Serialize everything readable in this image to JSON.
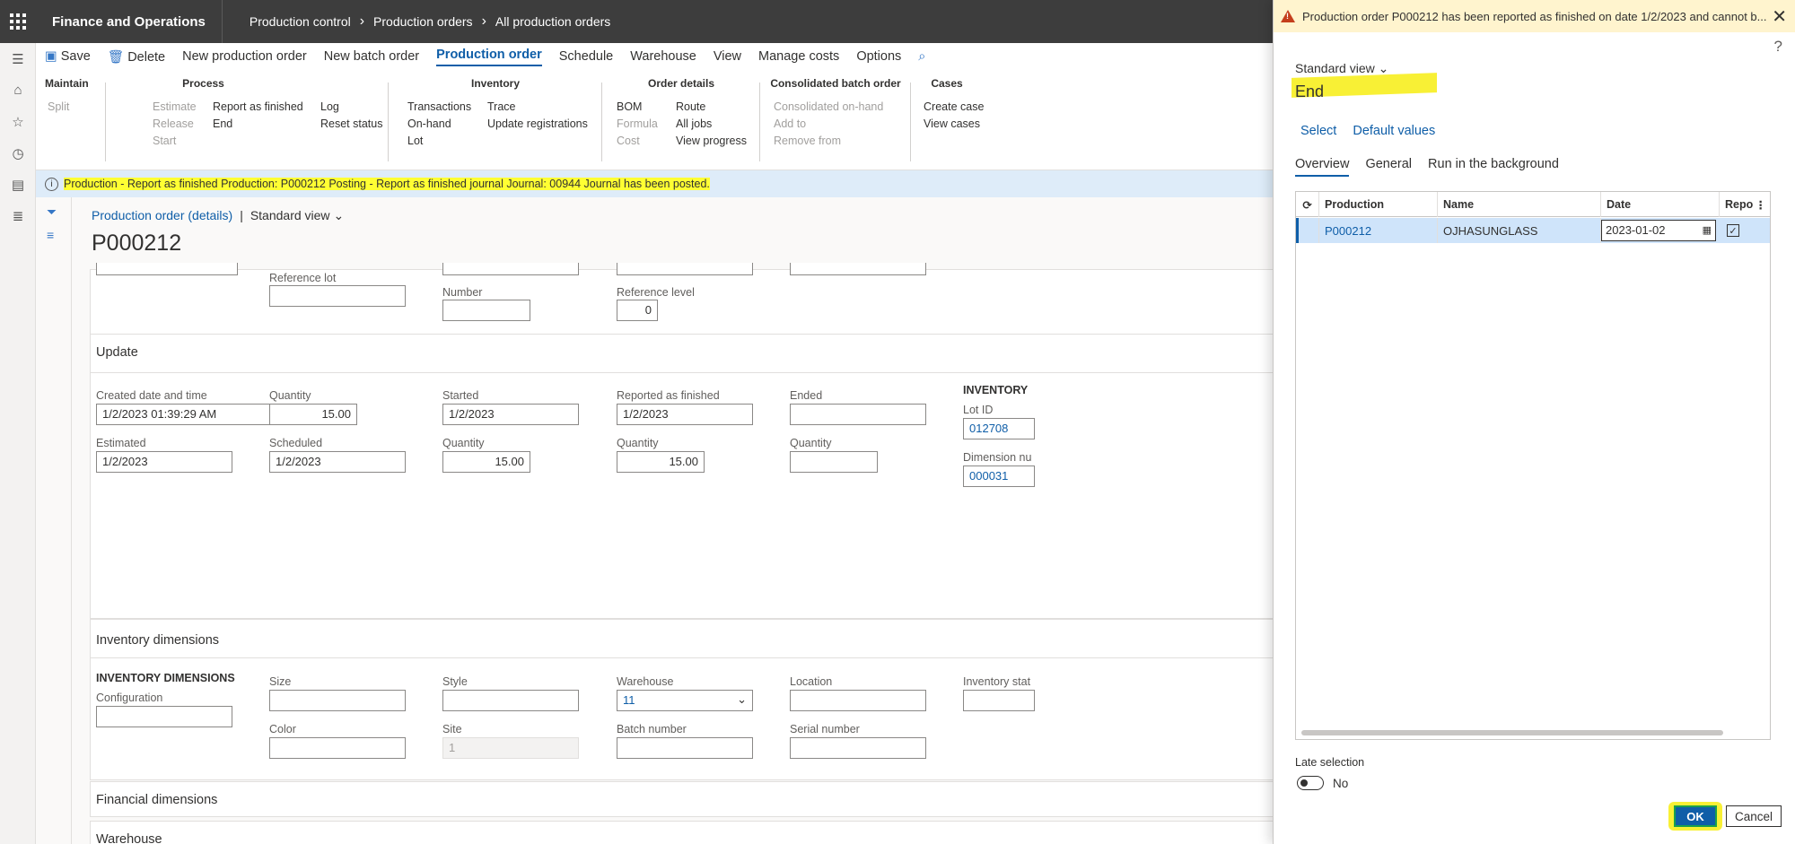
{
  "topbar": {
    "app_title": "Finance and Operations",
    "breadcrumb": [
      "Production control",
      "Production orders",
      "All production orders"
    ]
  },
  "actions": {
    "save": "Save",
    "delete": "Delete",
    "new_production_order": "New production order",
    "new_batch_order": "New batch order",
    "tabs": [
      "Production order",
      "Schedule",
      "Warehouse",
      "View",
      "Manage costs",
      "Options"
    ]
  },
  "ribbon": {
    "maintain": {
      "title": "Maintain",
      "split": "Split"
    },
    "process": {
      "title": "Process",
      "estimate": "Estimate",
      "release": "Release",
      "start": "Start",
      "report_as_finished": "Report as finished",
      "end": "End",
      "log": "Log",
      "reset_status": "Reset status"
    },
    "inventory": {
      "title": "Inventory",
      "transactions": "Transactions",
      "on_hand": "On-hand",
      "lot": "Lot",
      "trace": "Trace",
      "update_registrations": "Update registrations"
    },
    "order_details": {
      "title": "Order details",
      "bom": "BOM",
      "formula": "Formula",
      "cost": "Cost",
      "route": "Route",
      "all_jobs": "All jobs",
      "view_progress": "View progress"
    },
    "consolidated": {
      "title": "Consolidated batch order",
      "consolidated_on_hand": "Consolidated on-hand",
      "add_to": "Add to",
      "remove_from": "Remove from"
    },
    "cases": {
      "title": "Cases",
      "create_case": "Create case",
      "view_cases": "View cases"
    }
  },
  "infobar": {
    "message_highlighted": "Production - Report as finished  Production: P000212 Posting - Report as finished journal Journal: 00944 Journal has been posted.",
    "message_rest": ""
  },
  "page": {
    "crumb": "Production order (details)",
    "view": "Standard view",
    "title": "P000212"
  },
  "references": {
    "reference_lot_label": "Reference lot",
    "number_label": "Number",
    "reference_level_label": "Reference level",
    "reference_level_value": "0"
  },
  "update": {
    "title": "Update",
    "created_label": "Created date and time",
    "created_value": "1/2/2023 01:39:29 AM",
    "quantity_label": "Quantity",
    "quantity_value": "15.00",
    "started_label": "Started",
    "started_value": "1/2/2023",
    "reported_label": "Reported as finished",
    "reported_value": "1/2/2023",
    "ended_label": "Ended",
    "estimated_label": "Estimated",
    "estimated_value": "1/2/2023",
    "scheduled_label": "Scheduled",
    "scheduled_value": "1/2/2023",
    "quantity2_label": "Quantity",
    "quantity2_value": "15.00",
    "quantity3_label": "Quantity",
    "quantity3_value": "15.00",
    "quantity4_label": "Quantity",
    "inventory_heading": "INVENTORY",
    "lot_id_label": "Lot ID",
    "lot_id_value": "012708",
    "dimension_label": "Dimension nu",
    "dimension_value": "000031"
  },
  "inventory_dimensions": {
    "title": "Inventory dimensions",
    "heading": "INVENTORY DIMENSIONS",
    "configuration": "Configuration",
    "size": "Size",
    "color": "Color",
    "style": "Style",
    "site": "Site",
    "site_value": "1",
    "warehouse": "Warehouse",
    "warehouse_value": "11",
    "batch_number": "Batch number",
    "location": "Location",
    "serial_number": "Serial number",
    "inventory_status": "Inventory stat"
  },
  "sections": {
    "financial_dimensions": "Financial dimensions",
    "warehouse": "Warehouse"
  },
  "dialog": {
    "warning": "Production order P000212 has been reported as finished on date 1/2/2023 and cannot b...",
    "help": "?",
    "view": "Standard view",
    "title": "End",
    "select": "Select",
    "default_values": "Default values",
    "tabs": [
      "Overview",
      "General",
      "Run in the background"
    ],
    "grid": {
      "headers": [
        "Production",
        "Name",
        "Date",
        "Repo"
      ],
      "row": {
        "production": "P000212",
        "name": "OJHASUNGLASS",
        "date": "2023-01-02"
      }
    },
    "late_selection_label": "Late selection",
    "late_selection_value": "No",
    "ok": "OK",
    "cancel": "Cancel"
  },
  "colors": {
    "topbar": "#3d3d3d",
    "accent": "#0f5ea8",
    "highlight": "#ffff33",
    "infobar": "#deecf9",
    "warnbar": "#fff4ce"
  }
}
